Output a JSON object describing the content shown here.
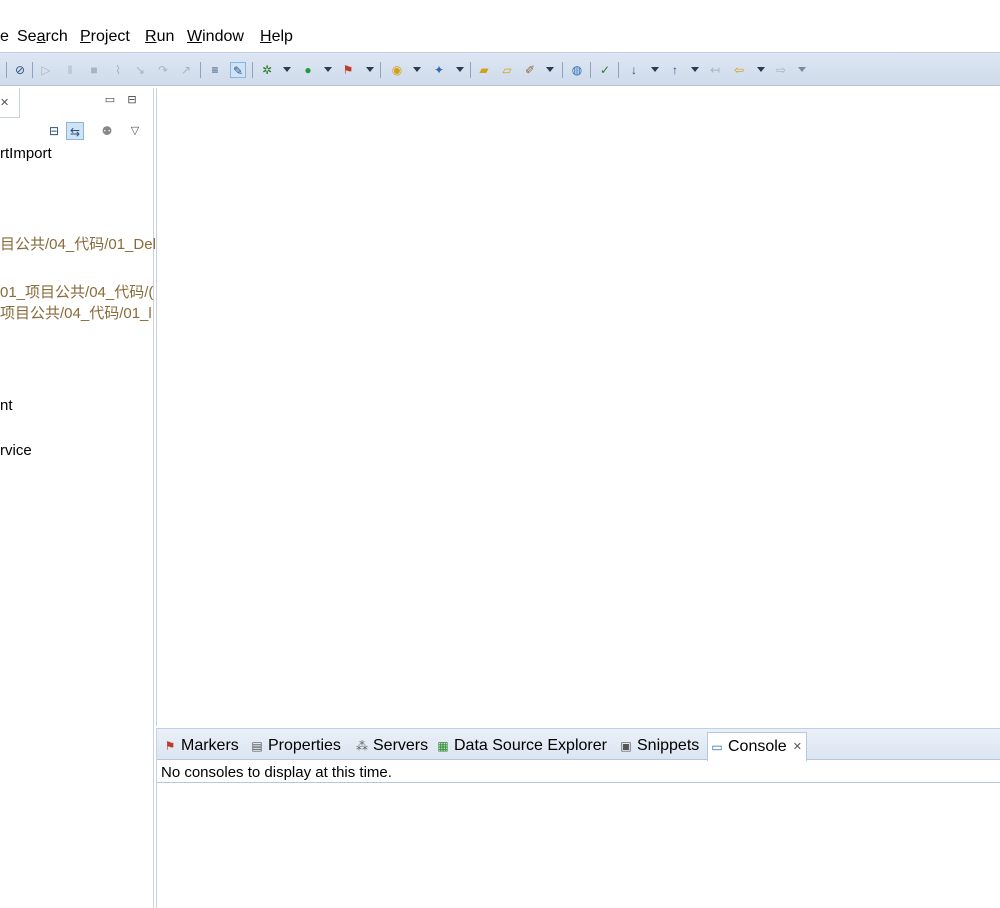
{
  "menubar": {
    "items": [
      {
        "before": "",
        "mnemonic": "",
        "after": "e"
      },
      {
        "before": "Se",
        "mnemonic": "a",
        "after": "rch"
      },
      {
        "before": "",
        "mnemonic": "P",
        "after": "roject"
      },
      {
        "before": "",
        "mnemonic": "R",
        "after": "un"
      },
      {
        "before": "",
        "mnemonic": "W",
        "after": "indow"
      },
      {
        "before": "",
        "mnemonic": "H",
        "after": "elp"
      }
    ]
  },
  "left_panel": {
    "tab_close": "✕",
    "minimize": "▭",
    "maximize": "⊟",
    "tree_items": [
      "rtImport",
      "目公共/04_代码/01_Del",
      "01_项目公共/04_代码/(",
      "项目公共/04_代码/01_l",
      "nt",
      "rvice"
    ]
  },
  "bottom_panel": {
    "tabs": [
      {
        "label": "Markers",
        "icon": "markers-icon"
      },
      {
        "label": "Properties",
        "icon": "properties-icon"
      },
      {
        "label": "Servers",
        "icon": "servers-icon"
      },
      {
        "label": "Data Source Explorer",
        "icon": "data-source-icon"
      },
      {
        "label": "Snippets",
        "icon": "snippets-icon"
      },
      {
        "label": "Console",
        "icon": "console-icon",
        "active": true
      }
    ],
    "console_close": "✕",
    "console_message": "No consoles to display at this time."
  }
}
